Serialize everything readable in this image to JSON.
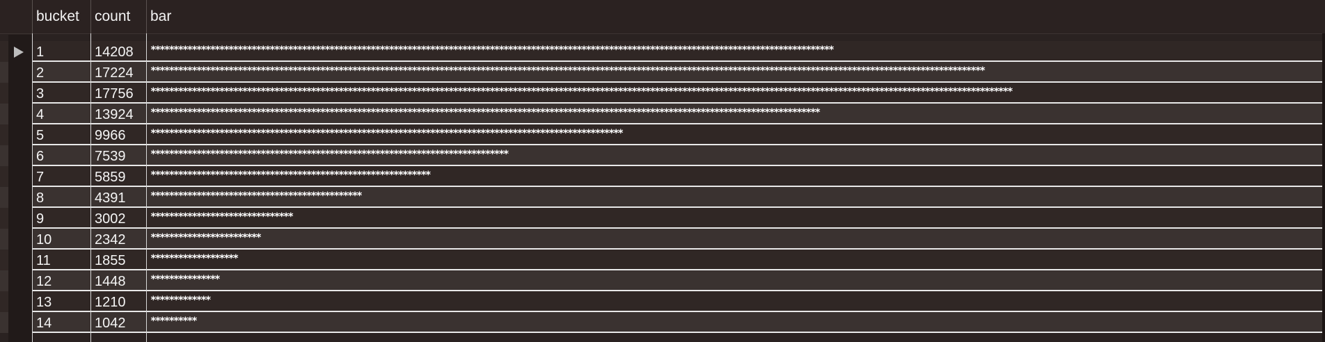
{
  "columns": {
    "bucket": "bucket",
    "count": "count",
    "bar": "bar"
  },
  "rows": [
    {
      "bucket": "1",
      "count": "14208",
      "bar": "*****************************************************************************************************************************************************"
    },
    {
      "bucket": "2",
      "count": "17224",
      "bar": "**************************************************************************************************************************************************************************************"
    },
    {
      "bucket": "3",
      "count": "17756",
      "bar": "********************************************************************************************************************************************************************************************"
    },
    {
      "bucket": "4",
      "count": "13924",
      "bar": "**************************************************************************************************************************************************"
    },
    {
      "bucket": "5",
      "count": "9966",
      "bar": "*******************************************************************************************************"
    },
    {
      "bucket": "6",
      "count": "7539",
      "bar": "******************************************************************************"
    },
    {
      "bucket": "7",
      "count": "5859",
      "bar": "*************************************************************"
    },
    {
      "bucket": "8",
      "count": "4391",
      "bar": "**********************************************"
    },
    {
      "bucket": "9",
      "count": "3002",
      "bar": "*******************************"
    },
    {
      "bucket": "10",
      "count": "2342",
      "bar": "************************"
    },
    {
      "bucket": "11",
      "count": "1855",
      "bar": "*******************"
    },
    {
      "bucket": "12",
      "count": "1448",
      "bar": "***************"
    },
    {
      "bucket": "13",
      "count": "1210",
      "bar": "*************"
    },
    {
      "bucket": "14",
      "count": "1042",
      "bar": "**********"
    }
  ],
  "current_row_marker": "play-triangle-icon"
}
